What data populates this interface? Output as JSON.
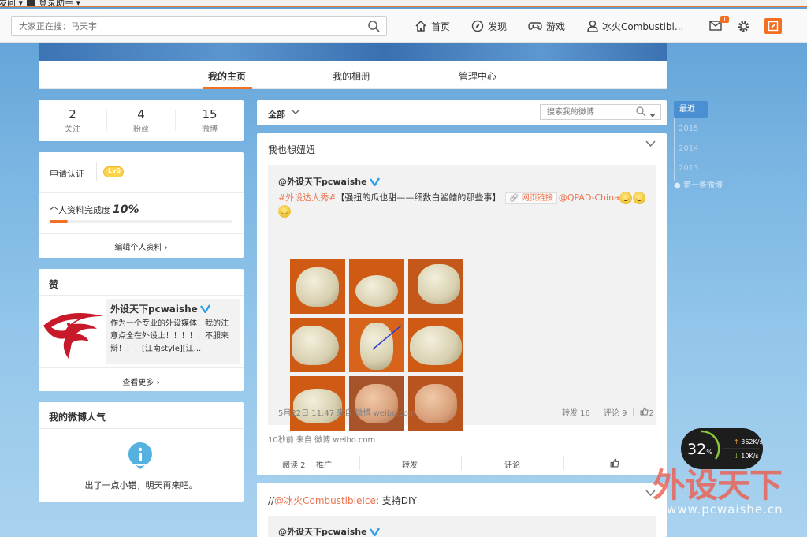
{
  "browser_bar": {
    "item1": "发问 ▾",
    "item2": "登录助手 ▾"
  },
  "topnav": {
    "search_placeholder": "大家正在搜：马天宇",
    "home": "首页",
    "discover": "发现",
    "games": "游戏",
    "username": "冰火Combustibl...",
    "msg_count": "1"
  },
  "tabs": {
    "home": "我的主页",
    "album": "我的相册",
    "manage": "管理中心"
  },
  "stats": [
    {
      "count": "2",
      "label": "关注"
    },
    {
      "count": "4",
      "label": "粉丝"
    },
    {
      "count": "15",
      "label": "微博"
    }
  ],
  "profile": {
    "verify_label": "申请认证",
    "level": "Lv6",
    "completeness_label": "个人资料完成度",
    "completeness_value": "10%",
    "completeness_fraction": 0.1,
    "edit_label": "编辑个人资料"
  },
  "liked": {
    "title": "赞",
    "name": "外设天下pcwaishe",
    "description": "作为一个专业的外设媒体！我的注意点全在外设上！！！！！不服来辩！！！[江南style][江...",
    "see_more": "查看更多"
  },
  "popular": {
    "title": "我的微博人气",
    "error": "出了一点小错，明天再来吧。"
  },
  "feed": {
    "filter_label": "全部",
    "search_placeholder": "搜索我的微博",
    "post1": {
      "text": "我也想妞妞",
      "orig_author": "@外设天下pcwaishe",
      "orig_topic": "#外设达人秀#",
      "orig_title": "【强扭的瓜也甜——细数白鲨鳍的那些事】",
      "orig_link": "网页链接",
      "orig_mention": "@QPAD-China",
      "orig_meta": "5月22日 11:47 来自 微博 weibo.com",
      "orig_repost": "转发 16",
      "orig_comment": "评论 9",
      "orig_like": "2",
      "meta": "10秒前 来自 微博 weibo.com",
      "read": "阅读 2",
      "promote": "推广",
      "repost": "转发",
      "comment": "评论"
    },
    "post2": {
      "prefix": "//",
      "mention": "@冰火CombustibleIce",
      "colon": ":",
      "text": " 支持DIY",
      "orig_author": "@外设天下pcwaishe"
    }
  },
  "timeline": {
    "recent": "最近",
    "years": [
      "2015",
      "2014",
      "2013"
    ],
    "first": "第一条微博"
  },
  "netmon": {
    "percent": "32",
    "unit": "%",
    "up": "362K/s",
    "down": "10K/s"
  },
  "watermark": {
    "logo": "外设天下",
    "url": "www.pcwaishe.cn"
  },
  "colors": {
    "accent": "#f36f21",
    "link": "#eb7350",
    "verified": "#2c9de8"
  }
}
